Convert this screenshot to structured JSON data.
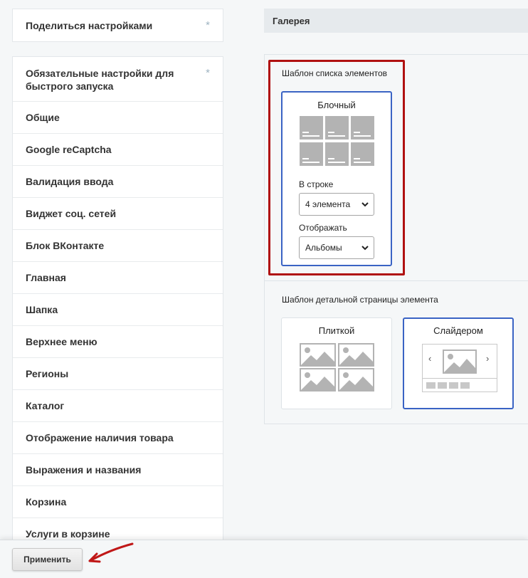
{
  "sidebar": {
    "share_label": "Поделиться настройками",
    "star_glyph": "*",
    "items": [
      "Обязательные настройки для быстрого запуска",
      "Общие",
      "Google reCaptcha",
      "Валидация ввода",
      "Виджет соц. сетей",
      "Блок ВКонтакте",
      "Главная",
      "Шапка",
      "Верхнее меню",
      "Регионы",
      "Каталог",
      "Отображение наличия товара",
      "Выражения и названия",
      "Корзина",
      "Услуги в корзине"
    ]
  },
  "section": {
    "title": "Галерея"
  },
  "list_template": {
    "label": "Шаблон списка элементов",
    "option_title": "Блочный",
    "per_row_label": "В строке",
    "per_row_value": "4 элемента",
    "display_label": "Отображать",
    "display_value": "Альбомы"
  },
  "detail_template": {
    "label": "Шаблон детальной страницы элемента",
    "option_tile": "Плиткой",
    "option_slider": "Слайдером",
    "slider_prev": "‹",
    "slider_next": "›"
  },
  "footer": {
    "apply_label": "Применить"
  },
  "colors": {
    "highlight": "#b01111",
    "active_border": "#3a63c4",
    "arrow": "#c01818"
  }
}
